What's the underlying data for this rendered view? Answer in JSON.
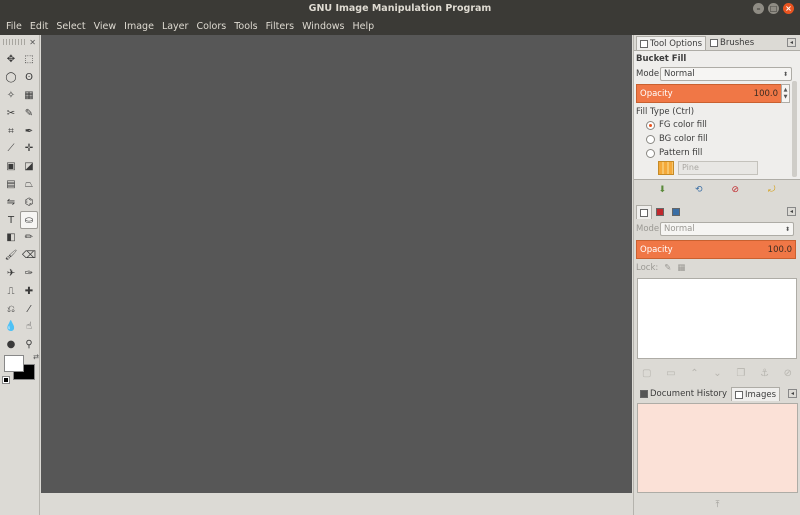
{
  "window": {
    "title": "GNU Image Manipulation Program"
  },
  "menu": [
    "File",
    "Edit",
    "Select",
    "View",
    "Image",
    "Layer",
    "Colors",
    "Tools",
    "Filters",
    "Windows",
    "Help"
  ],
  "toolbox": {
    "tools": [
      {
        "name": "move-tool-icon",
        "glyph": "✥"
      },
      {
        "name": "rect-select-icon",
        "glyph": "⬚"
      },
      {
        "name": "ellipse-select-icon",
        "glyph": "◯"
      },
      {
        "name": "free-select-icon",
        "glyph": "ʘ"
      },
      {
        "name": "fuzzy-select-icon",
        "glyph": "✧"
      },
      {
        "name": "select-by-color-icon",
        "glyph": "▦"
      },
      {
        "name": "scissors-select-icon",
        "glyph": "✂"
      },
      {
        "name": "foreground-select-icon",
        "glyph": "✎"
      },
      {
        "name": "crop-icon",
        "glyph": "⌗"
      },
      {
        "name": "paths-icon",
        "glyph": "✒"
      },
      {
        "name": "measure-icon",
        "glyph": "⟋"
      },
      {
        "name": "align-icon",
        "glyph": "✛"
      },
      {
        "name": "transform-icon",
        "glyph": "▣"
      },
      {
        "name": "scale-icon",
        "glyph": "◪"
      },
      {
        "name": "shear-icon",
        "glyph": "▤"
      },
      {
        "name": "perspective-icon",
        "glyph": "⏢"
      },
      {
        "name": "flip-icon",
        "glyph": "⇋"
      },
      {
        "name": "cage-icon",
        "glyph": "⌬"
      },
      {
        "name": "text-tool-icon",
        "glyph": "T"
      },
      {
        "name": "bucket-fill-icon",
        "glyph": "⛀",
        "active": true
      },
      {
        "name": "gradient-icon",
        "glyph": "◧"
      },
      {
        "name": "pencil-icon",
        "glyph": "✏"
      },
      {
        "name": "paintbrush-icon",
        "glyph": "🖌"
      },
      {
        "name": "eraser-icon",
        "glyph": "⌫"
      },
      {
        "name": "airbrush-icon",
        "glyph": "✈"
      },
      {
        "name": "ink-icon",
        "glyph": "✑"
      },
      {
        "name": "clone-icon",
        "glyph": "⎍"
      },
      {
        "name": "heal-icon",
        "glyph": "✚"
      },
      {
        "name": "perspective-clone-icon",
        "glyph": "⎌"
      },
      {
        "name": "color-picker-icon",
        "glyph": "⁄"
      },
      {
        "name": "blur-icon",
        "glyph": "💧"
      },
      {
        "name": "smudge-icon",
        "glyph": "☝"
      },
      {
        "name": "dodge-burn-icon",
        "glyph": "●"
      },
      {
        "name": "zoom-icon",
        "glyph": "⚲"
      }
    ],
    "fg_color": "#ffffff",
    "bg_color": "#000000"
  },
  "tool_options": {
    "tabs": [
      "Tool Options",
      "Brushes"
    ],
    "title": "Bucket Fill",
    "mode_label": "Mode:",
    "mode_value": "Normal",
    "opacity_label": "Opacity",
    "opacity_value": "100.0",
    "fill_type_label": "Fill Type  (Ctrl)",
    "fill_types": [
      "FG color fill",
      "BG color fill",
      "Pattern fill"
    ],
    "selected_fill": 0,
    "pattern_name": "Pine"
  },
  "layers": {
    "mode_label": "Mode:",
    "mode_value": "Normal",
    "opacity_label": "Opacity",
    "opacity_value": "100.0",
    "lock_label": "Lock:"
  },
  "images_panel": {
    "tabs": [
      "Document History",
      "Images"
    ]
  },
  "colors": {
    "accent": "#f07746",
    "canvas": "#575757",
    "titlebar": "#3b3a36",
    "close": "#e95420"
  }
}
